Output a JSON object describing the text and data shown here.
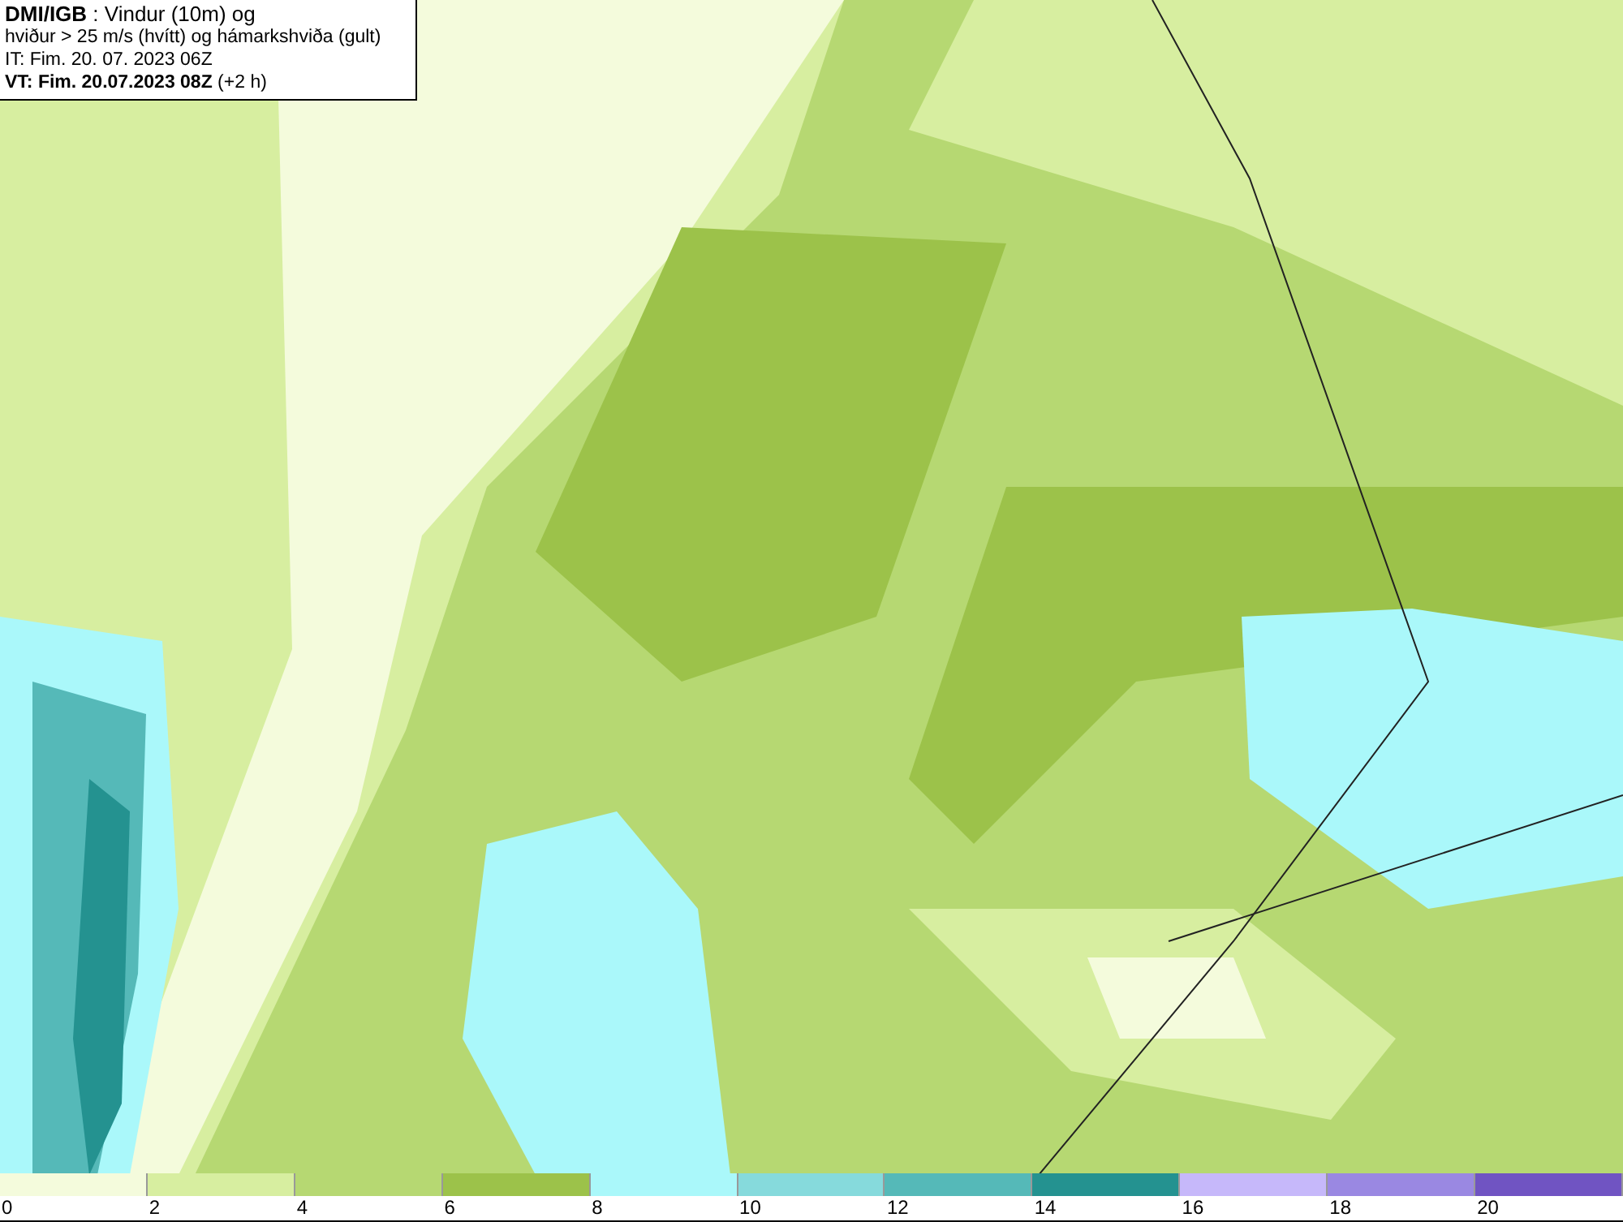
{
  "title_box": {
    "lines": [
      "**DMI/IGB** : Vindur (10m) og",
      "hviður > 25 m/s (hvítt) og hámarkshviða (gult)",
      "IT: Fim. 20. 07. 2023 06Z",
      "**VT: Fim. 20.07.2023 08Z** (+2 h)"
    ]
  },
  "legend": {
    "bins": [
      {
        "label": "0",
        "color": "#f4fbdc"
      },
      {
        "label": "2",
        "color": "#d7eea0"
      },
      {
        "label": "4",
        "color": "#b6d872"
      },
      {
        "label": "6",
        "color": "#9cc24a"
      },
      {
        "label": "8",
        "color": "#aaf8fa"
      },
      {
        "label": "10",
        "color": "#86dadc"
      },
      {
        "label": "12",
        "color": "#55b9b8"
      },
      {
        "label": "14",
        "color": "#249290"
      },
      {
        "label": "16",
        "color": "#c6b8fa"
      },
      {
        "label": "18",
        "color": "#9a88e2"
      },
      {
        "label": "20",
        "color": "#7054c2"
      }
    ]
  }
}
